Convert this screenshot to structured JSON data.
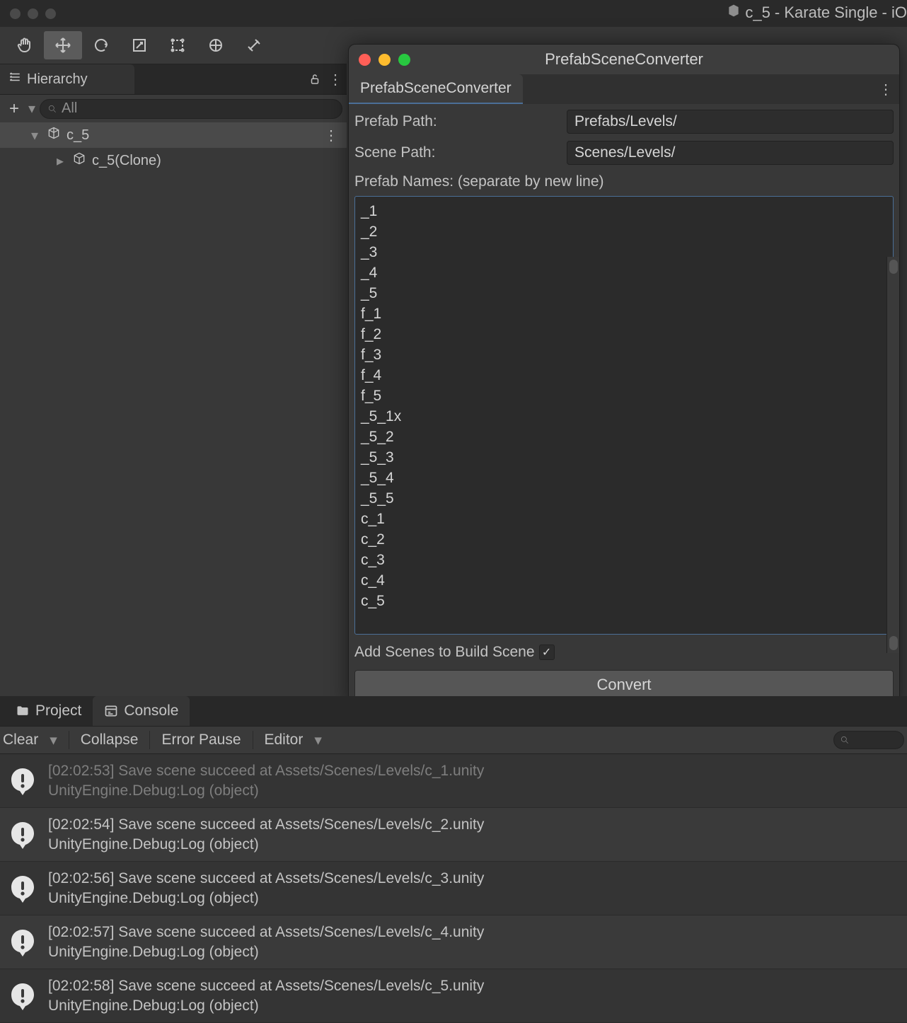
{
  "app_title": "c_5 - Karate Single - iO",
  "tools": {
    "hand": "hand-icon",
    "move": "move-icon",
    "rotate": "rotate-icon",
    "scale": "scale-icon",
    "rect": "rect-icon",
    "transform": "transform-icon",
    "custom": "custom-icon"
  },
  "hierarchy": {
    "tab_label": "Hierarchy",
    "search_placeholder": "All",
    "root": {
      "label": "c_5"
    },
    "child": {
      "label": "c_5(Clone)"
    }
  },
  "converter": {
    "window_title": "PrefabSceneConverter",
    "tab_label": "PrefabSceneConverter",
    "prefab_path_label": "Prefab Path:",
    "prefab_path_value": "Prefabs/Levels/",
    "scene_path_label": "Scene Path:",
    "scene_path_value": "Scenes/Levels/",
    "names_label": "Prefab Names: (separate by new line)",
    "names_text": "_1\n_2\n_3\n_4\n_5\nf_1\nf_2\nf_3\nf_4\nf_5\n_5_1x\n_5_2\n_5_3\n_5_4\n_5_5\nc_1\nc_2\nc_3\nc_4\nc_5",
    "add_scenes_label": "Add Scenes to Build Scene",
    "add_scenes_checked": true,
    "convert_label": "Convert"
  },
  "bottom_tabs": {
    "project": "Project",
    "console": "Console"
  },
  "console_toolbar": {
    "clear": "Clear",
    "collapse": "Collapse",
    "error_pause": "Error Pause",
    "editor": "Editor"
  },
  "console": [
    {
      "dim": true,
      "line1": "[02:02:53] Save scene succeed at Assets/Scenes/Levels/c_1.unity",
      "line2": "UnityEngine.Debug:Log (object)"
    },
    {
      "line1": "[02:02:54] Save scene succeed at Assets/Scenes/Levels/c_2.unity",
      "line2": "UnityEngine.Debug:Log (object)"
    },
    {
      "line1": "[02:02:56] Save scene succeed at Assets/Scenes/Levels/c_3.unity",
      "line2": "UnityEngine.Debug:Log (object)"
    },
    {
      "line1": "[02:02:57] Save scene succeed at Assets/Scenes/Levels/c_4.unity",
      "line2": "UnityEngine.Debug:Log (object)"
    },
    {
      "line1": "[02:02:58] Save scene succeed at Assets/Scenes/Levels/c_5.unity",
      "line2": "UnityEngine.Debug:Log (object)"
    }
  ]
}
